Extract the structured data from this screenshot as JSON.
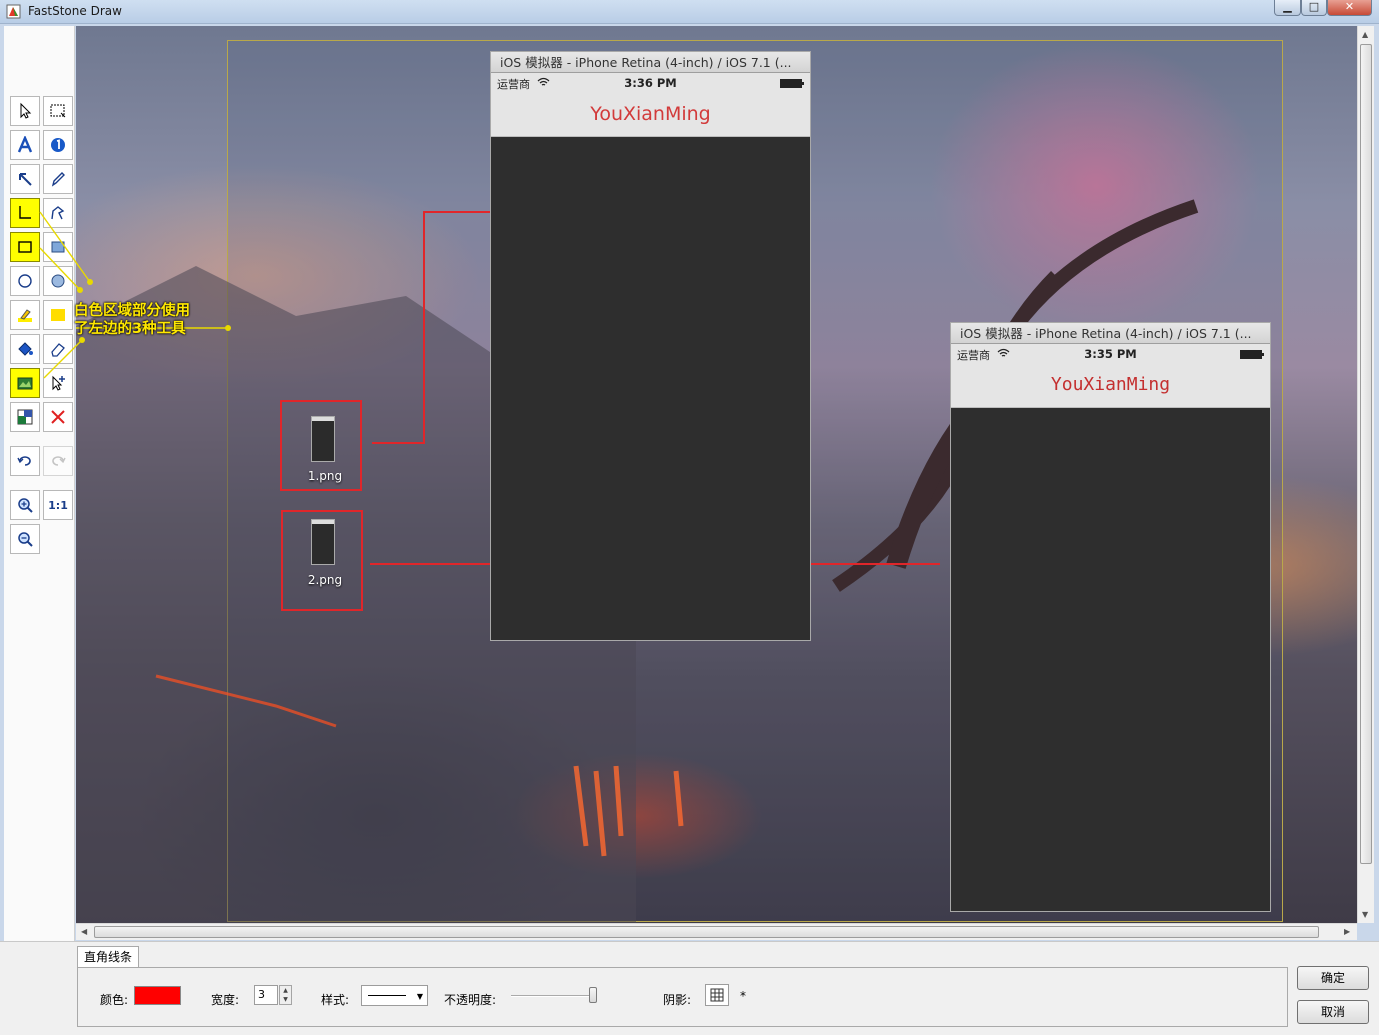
{
  "window": {
    "title": "FastStone Draw",
    "controls": {
      "minimize": "▁",
      "maximize": "□",
      "close": "✕"
    }
  },
  "tools": [
    {
      "name": "select-arrow-tool",
      "icon": "pointer-icon"
    },
    {
      "name": "marquee-select-tool",
      "icon": "marquee-icon"
    },
    {
      "name": "text-tool",
      "icon": "text-a-icon"
    },
    {
      "name": "number-stamp-tool",
      "icon": "number-badge-icon"
    },
    {
      "name": "arrow-line-tool",
      "icon": "arrow-icon"
    },
    {
      "name": "pencil-tool",
      "icon": "pencil-icon"
    },
    {
      "name": "right-angle-line-tool",
      "icon": "right-angle-icon",
      "selected": true
    },
    {
      "name": "polyline-tool",
      "icon": "polygon-icon"
    },
    {
      "name": "rectangle-tool",
      "icon": "rectangle-icon",
      "selected": true
    },
    {
      "name": "filled-rectangle-tool",
      "icon": "filled-rectangle-icon"
    },
    {
      "name": "ellipse-tool",
      "icon": "ellipse-icon"
    },
    {
      "name": "filled-ellipse-tool",
      "icon": "filled-ellipse-icon"
    },
    {
      "name": "highlighter-tool",
      "icon": "highlighter-icon"
    },
    {
      "name": "fill-color-tool",
      "icon": "yellow-fill-icon"
    },
    {
      "name": "paint-bucket-tool",
      "icon": "bucket-icon"
    },
    {
      "name": "eraser-tool",
      "icon": "eraser-icon"
    },
    {
      "name": "insert-image-tool",
      "icon": "image-icon",
      "selected": true
    },
    {
      "name": "add-pointer-tool",
      "icon": "pointer-plus-icon"
    },
    {
      "name": "crop-canvas-tool",
      "icon": "canvas-icon"
    },
    {
      "name": "delete-tool",
      "icon": "red-x-icon"
    },
    {
      "name": "undo-button",
      "icon": "undo-icon"
    },
    {
      "name": "redo-button",
      "icon": "redo-icon",
      "disabled": true
    },
    {
      "name": "zoom-in-button",
      "icon": "zoom-in-icon"
    },
    {
      "name": "actual-size-button",
      "icon": "one-to-one-icon",
      "label": "1:1"
    },
    {
      "name": "zoom-out-button",
      "icon": "zoom-out-icon"
    }
  ],
  "annotation": {
    "line1": "白色区域部分使用",
    "line2": "了左边的3种工具"
  },
  "simulators": [
    {
      "title": "iOS 模拟器 - iPhone Retina (4-inch) / iOS 7.1 (...",
      "carrier": "运营商",
      "time": "3:36 PM",
      "app_title": "YouXianMing"
    },
    {
      "title": "iOS 模拟器 - iPhone Retina (4-inch) / iOS 7.1 (...",
      "carrier": "运营商",
      "time": "3:35 PM",
      "app_title": "YouXianMing"
    }
  ],
  "files": [
    {
      "name": "1.png"
    },
    {
      "name": "2.png"
    }
  ],
  "properties": {
    "tab": "直角线条",
    "color_label": "颜色:",
    "color_value": "#ff0000",
    "width_label": "宽度:",
    "width_value": "3",
    "style_label": "样式:",
    "opacity_label": "不透明度:",
    "opacity_value": 1.0,
    "shadow_label": "阴影:",
    "shadow_extra": "*"
  },
  "dialog": {
    "ok": "确定",
    "cancel": "取消"
  },
  "colors": {
    "accent_red": "#e0262a",
    "selected_tool": "#ffff00",
    "annotation_yellow": "#ffe800"
  }
}
